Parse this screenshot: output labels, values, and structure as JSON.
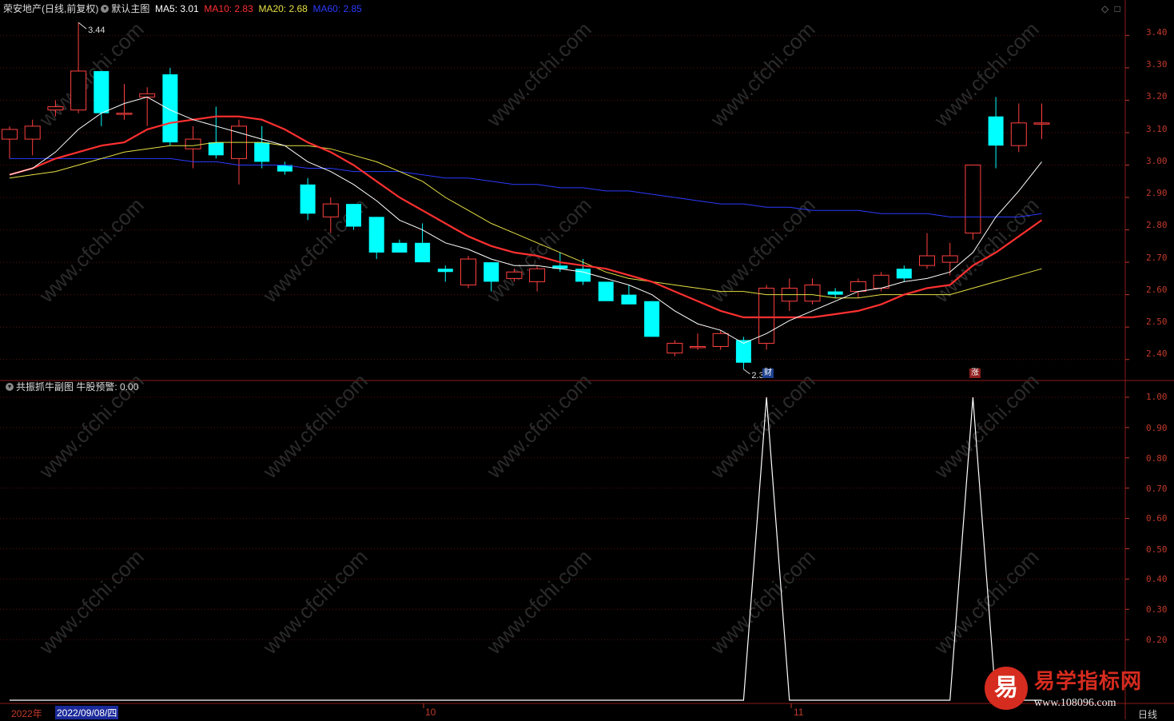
{
  "header": {
    "stock_name": "荣安地产(日线,前复权)",
    "main_chart_label": "默认主图",
    "ma5": "MA5: 3.01",
    "ma10": "MA10: 2.83",
    "ma20": "MA20: 2.68",
    "ma60": "MA60: 2.85",
    "colors": {
      "ma5": "#ffffff",
      "ma10": "#ff3030",
      "ma20": "#e5e045",
      "ma60": "#2b3bff"
    }
  },
  "sub_header": {
    "indicator_name": "共振抓牛副图",
    "value": "牛股预警: 0.00"
  },
  "price_axis": [
    "3.40",
    "3.30",
    "3.20",
    "3.10",
    "3.00",
    "2.90",
    "2.80",
    "2.70",
    "2.60",
    "2.50",
    "2.40"
  ],
  "sub_axis": [
    "1.00",
    "0.90",
    "0.80",
    "0.70",
    "0.60",
    "0.50",
    "0.40",
    "0.30",
    "0.20"
  ],
  "annotations": {
    "high": "3.44",
    "low": "2.37",
    "badge_cai": "财",
    "badge_zhang": "涨"
  },
  "bottom": {
    "year": "2022年",
    "cursor_date": "2022/09/08/四",
    "month_10": "10",
    "month_11": "11",
    "period": "日线"
  },
  "watermark": "www.cfchi.com",
  "logo": {
    "char": "易",
    "title": "易学指标网",
    "url": "www.108096.com"
  },
  "chart_data": {
    "type": "candlestick",
    "candles": [
      {
        "o": 3.08,
        "h": 3.12,
        "l": 3.02,
        "c": 3.11
      },
      {
        "o": 3.08,
        "h": 3.14,
        "l": 3.03,
        "c": 3.12
      },
      {
        "o": 3.17,
        "h": 3.2,
        "l": 3.15,
        "c": 3.18
      },
      {
        "o": 3.17,
        "h": 3.44,
        "l": 3.16,
        "c": 3.29
      },
      {
        "o": 3.29,
        "h": 3.29,
        "l": 3.12,
        "c": 3.16
      },
      {
        "o": 3.16,
        "h": 3.25,
        "l": 3.14,
        "c": 3.16
      },
      {
        "o": 3.21,
        "h": 3.24,
        "l": 3.12,
        "c": 3.22
      },
      {
        "o": 3.28,
        "h": 3.3,
        "l": 3.06,
        "c": 3.07
      },
      {
        "o": 3.05,
        "h": 3.12,
        "l": 2.99,
        "c": 3.08
      },
      {
        "o": 3.07,
        "h": 3.18,
        "l": 3.02,
        "c": 3.03
      },
      {
        "o": 3.02,
        "h": 3.14,
        "l": 2.94,
        "c": 3.12
      },
      {
        "o": 3.07,
        "h": 3.12,
        "l": 2.99,
        "c": 3.01
      },
      {
        "o": 3.0,
        "h": 3.01,
        "l": 2.97,
        "c": 2.98
      },
      {
        "o": 2.94,
        "h": 2.96,
        "l": 2.83,
        "c": 2.85
      },
      {
        "o": 2.84,
        "h": 2.9,
        "l": 2.79,
        "c": 2.88
      },
      {
        "o": 2.88,
        "h": 2.88,
        "l": 2.8,
        "c": 2.81
      },
      {
        "o": 2.84,
        "h": 2.84,
        "l": 2.71,
        "c": 2.73
      },
      {
        "o": 2.76,
        "h": 2.77,
        "l": 2.73,
        "c": 2.73
      },
      {
        "o": 2.76,
        "h": 2.82,
        "l": 2.7,
        "c": 2.7
      },
      {
        "o": 2.68,
        "h": 2.69,
        "l": 2.64,
        "c": 2.67
      },
      {
        "o": 2.63,
        "h": 2.72,
        "l": 2.62,
        "c": 2.71
      },
      {
        "o": 2.7,
        "h": 2.7,
        "l": 2.61,
        "c": 2.64
      },
      {
        "o": 2.65,
        "h": 2.68,
        "l": 2.64,
        "c": 2.67
      },
      {
        "o": 2.64,
        "h": 2.69,
        "l": 2.61,
        "c": 2.68
      },
      {
        "o": 2.69,
        "h": 2.73,
        "l": 2.67,
        "c": 2.68
      },
      {
        "o": 2.68,
        "h": 2.71,
        "l": 2.63,
        "c": 2.64
      },
      {
        "o": 2.64,
        "h": 2.64,
        "l": 2.58,
        "c": 2.58
      },
      {
        "o": 2.6,
        "h": 2.63,
        "l": 2.57,
        "c": 2.57
      },
      {
        "o": 2.58,
        "h": 2.58,
        "l": 2.47,
        "c": 2.47
      },
      {
        "o": 2.42,
        "h": 2.46,
        "l": 2.41,
        "c": 2.45
      },
      {
        "o": 2.44,
        "h": 2.48,
        "l": 2.43,
        "c": 2.44
      },
      {
        "o": 2.44,
        "h": 2.49,
        "l": 2.43,
        "c": 2.48
      },
      {
        "o": 2.46,
        "h": 2.47,
        "l": 2.37,
        "c": 2.39
      },
      {
        "o": 2.45,
        "h": 2.63,
        "l": 2.43,
        "c": 2.62
      },
      {
        "o": 2.58,
        "h": 2.65,
        "l": 2.55,
        "c": 2.62
      },
      {
        "o": 2.58,
        "h": 2.65,
        "l": 2.57,
        "c": 2.63
      },
      {
        "o": 2.61,
        "h": 2.62,
        "l": 2.59,
        "c": 2.6
      },
      {
        "o": 2.61,
        "h": 2.65,
        "l": 2.59,
        "c": 2.64
      },
      {
        "o": 2.62,
        "h": 2.67,
        "l": 2.61,
        "c": 2.66
      },
      {
        "o": 2.68,
        "h": 2.69,
        "l": 2.64,
        "c": 2.65
      },
      {
        "o": 2.69,
        "h": 2.79,
        "l": 2.68,
        "c": 2.72
      },
      {
        "o": 2.7,
        "h": 2.76,
        "l": 2.66,
        "c": 2.72
      },
      {
        "o": 2.79,
        "h": 3.0,
        "l": 2.77,
        "c": 3.0
      },
      {
        "o": 3.15,
        "h": 3.21,
        "l": 2.99,
        "c": 3.06
      },
      {
        "o": 3.06,
        "h": 3.19,
        "l": 3.04,
        "c": 3.13
      },
      {
        "o": 3.13,
        "h": 3.19,
        "l": 3.08,
        "c": 3.13
      }
    ],
    "ma5": [
      2.97,
      2.99,
      3.04,
      3.11,
      3.16,
      3.19,
      3.21,
      3.17,
      3.14,
      3.12,
      3.1,
      3.08,
      3.06,
      3.01,
      2.98,
      2.94,
      2.89,
      2.83,
      2.8,
      2.76,
      2.74,
      2.71,
      2.69,
      2.69,
      2.68,
      2.67,
      2.65,
      2.63,
      2.6,
      2.55,
      2.51,
      2.49,
      2.45,
      2.48,
      2.52,
      2.55,
      2.58,
      2.61,
      2.62,
      2.64,
      2.65,
      2.67,
      2.73,
      2.84,
      2.92,
      3.01
    ],
    "ma10": [
      2.97,
      2.99,
      3.02,
      3.04,
      3.06,
      3.07,
      3.11,
      3.13,
      3.14,
      3.15,
      3.15,
      3.14,
      3.11,
      3.07,
      3.04,
      3.0,
      2.95,
      2.9,
      2.86,
      2.82,
      2.78,
      2.75,
      2.73,
      2.72,
      2.7,
      2.69,
      2.68,
      2.66,
      2.64,
      2.61,
      2.58,
      2.55,
      2.53,
      2.53,
      2.53,
      2.53,
      2.54,
      2.55,
      2.57,
      2.6,
      2.62,
      2.63,
      2.69,
      2.73,
      2.78,
      2.83
    ],
    "ma20": [
      2.96,
      2.97,
      2.98,
      3.0,
      3.02,
      3.04,
      3.05,
      3.06,
      3.06,
      3.07,
      3.07,
      3.07,
      3.06,
      3.06,
      3.05,
      3.03,
      3.01,
      2.98,
      2.95,
      2.9,
      2.86,
      2.82,
      2.79,
      2.76,
      2.73,
      2.7,
      2.67,
      2.65,
      2.64,
      2.63,
      2.62,
      2.61,
      2.61,
      2.6,
      2.6,
      2.6,
      2.59,
      2.59,
      2.6,
      2.6,
      2.6,
      2.6,
      2.62,
      2.64,
      2.66,
      2.68
    ],
    "ma60": [
      3.02,
      3.02,
      3.02,
      3.02,
      3.02,
      3.02,
      3.02,
      3.02,
      3.01,
      3.01,
      3.0,
      3.0,
      3.0,
      2.99,
      2.99,
      2.98,
      2.98,
      2.98,
      2.97,
      2.96,
      2.96,
      2.95,
      2.94,
      2.94,
      2.93,
      2.93,
      2.92,
      2.92,
      2.91,
      2.9,
      2.89,
      2.88,
      2.88,
      2.87,
      2.87,
      2.86,
      2.86,
      2.86,
      2.85,
      2.85,
      2.85,
      2.84,
      2.84,
      2.84,
      2.84,
      2.85
    ],
    "signal": [
      0,
      0,
      0,
      0,
      0,
      0,
      0,
      0,
      0,
      0,
      0,
      0,
      0,
      0,
      0,
      0,
      0,
      0,
      0,
      0,
      0,
      0,
      0,
      0,
      0,
      0,
      0,
      0,
      0,
      0,
      0,
      0,
      0,
      1,
      0,
      0,
      0,
      0,
      0,
      0,
      0,
      0,
      1,
      0,
      0,
      0
    ],
    "price_ylim": [
      2.35,
      3.46
    ],
    "signal_ylim": [
      0,
      1.05
    ]
  }
}
